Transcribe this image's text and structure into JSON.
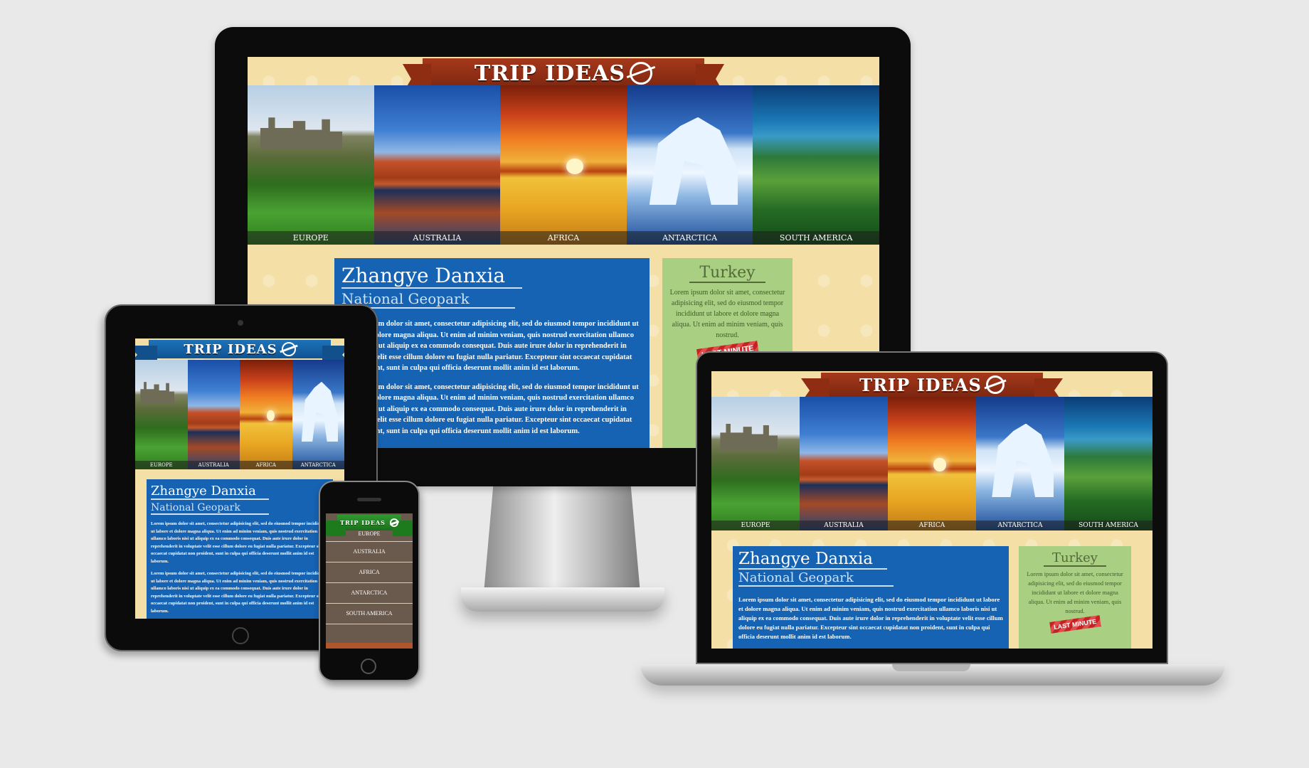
{
  "site": {
    "logo_text": "TRIP IDEAS",
    "gallery": [
      {
        "label": "EUROPE"
      },
      {
        "label": "AUSTRALIA"
      },
      {
        "label": "AFRICA"
      },
      {
        "label": "ANTARCTICA"
      },
      {
        "label": "SOUTH AMERICA"
      }
    ],
    "main": {
      "title": "Zhangye Danxia",
      "subtitle": "National Geopark",
      "paragraph1": "Lorem ipsum dolor sit amet, consectetur adipisicing elit, sed do eiusmod tempor incididunt ut labore et dolore magna aliqua. Ut enim ad minim veniam, quis nostrud exercitation ullamco laboris nisi ut aliquip ex ea commodo consequat. Duis aute irure dolor in reprehenderit in voluptate velit esse cillum dolore eu fugiat nulla pariatur. Excepteur sint occaecat cupidatat non proident, sunt in culpa qui officia deserunt mollit anim id est laborum.",
      "paragraph2": "Lorem ipsum dolor sit amet, consectetur adipisicing elit, sed do eiusmod tempor incididunt ut labore et dolore magna aliqua. Ut enim ad minim veniam, quis nostrud exercitation ullamco laboris nisi ut aliquip ex ea commodo consequat. Duis aute irure dolor in reprehenderit in voluptate velit esse cillum dolore eu fugiat nulla pariatur. Excepteur sint occaecat cupidatat non proident, sunt in culpa qui officia deserunt mollit anim id est laborum."
    },
    "sidebar": {
      "title": "Turkey",
      "text": "Lorem ipsum dolor sit amet, consectetur adipisicing elit, sed do eiusmod tempor incididunt ut labore et dolore magna aliqua. Ut enim ad minim veniam, quis nostrud.",
      "badge": "LAST MINUTE"
    }
  },
  "colors": {
    "ribbon_monitor": "#8e2d12",
    "ribbon_tablet": "#1662b3",
    "ribbon_phone": "#1f7f1f",
    "main_box": "#1662b3",
    "side_box": "#a9cf82",
    "page_bg": "#f4dfa6"
  },
  "icons": {
    "logo": "globe-plane-icon"
  }
}
